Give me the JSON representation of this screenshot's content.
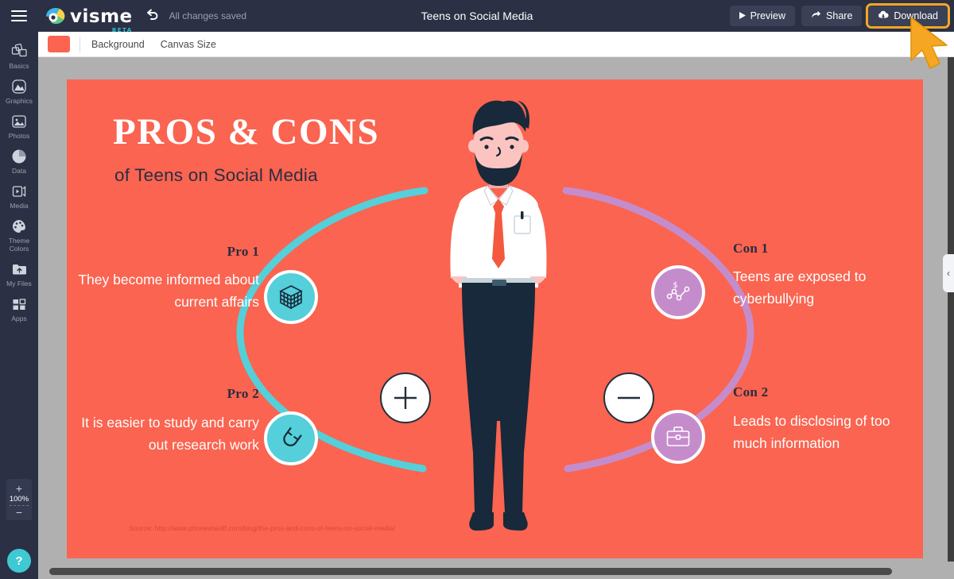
{
  "app": {
    "brand_name": "visme",
    "brand_badge": "BETA",
    "menu_icon": "hamburger-icon",
    "undo_icon": "undo-arrow-icon",
    "save_status": "All changes saved",
    "document_title": "Teens on Social Media"
  },
  "topbar_actions": [
    {
      "label": "Preview",
      "icon": "play-icon",
      "highlighted": false
    },
    {
      "label": "Share",
      "icon": "share-arrow-icon",
      "highlighted": false
    },
    {
      "label": "Download",
      "icon": "cloud-download-icon",
      "highlighted": true
    }
  ],
  "sidebar": {
    "items": [
      {
        "label": "Basics",
        "icon": "blocks-icon"
      },
      {
        "label": "Graphics",
        "icon": "shapes-icon"
      },
      {
        "label": "Photos",
        "icon": "image-icon"
      },
      {
        "label": "Data",
        "icon": "pie-chart-icon"
      },
      {
        "label": "Media",
        "icon": "video-icon"
      },
      {
        "label": "Theme Colors",
        "icon": "palette-icon"
      },
      {
        "label": "My Files",
        "icon": "upload-folder-icon"
      },
      {
        "label": "Apps",
        "icon": "grid-apps-icon"
      }
    ],
    "zoom": {
      "value": "100%",
      "plus": "+",
      "minus": "−"
    },
    "help_label": "?"
  },
  "subtoolbar": {
    "background_swatch_color": "#fa6450",
    "links": [
      "Background",
      "Canvas Size"
    ]
  },
  "canvas": {
    "background_color": "#fa6450",
    "heading": "PROS & CONS",
    "subheading": "of Teens on Social Media",
    "source": "Source: http://www.phonesheriff.com/blog/the-pros-and-cons-of-teens-on-social-media/",
    "plus_symbol": "+",
    "minus_symbol": "−",
    "pro_color": "#55cfd9",
    "con_color": "#c58ccb",
    "pros": [
      {
        "label": "Pro 1",
        "text": "They become informed about current affairs",
        "icon": "cube-icon"
      },
      {
        "label": "Pro 2",
        "text": "It is easier to study and carry out research work",
        "icon": "magnet-icon"
      }
    ],
    "cons": [
      {
        "label": "Con 1",
        "text": "Teens are exposed to cyberbullying",
        "icon": "line-chart-dollar-icon"
      },
      {
        "label": "Con 2",
        "text": "Leads to disclosing of too much information",
        "icon": "briefcase-icon"
      }
    ],
    "illustration": "businessman-with-beard-illustration"
  },
  "right_panel": {
    "collapse_chevron": "‹"
  }
}
